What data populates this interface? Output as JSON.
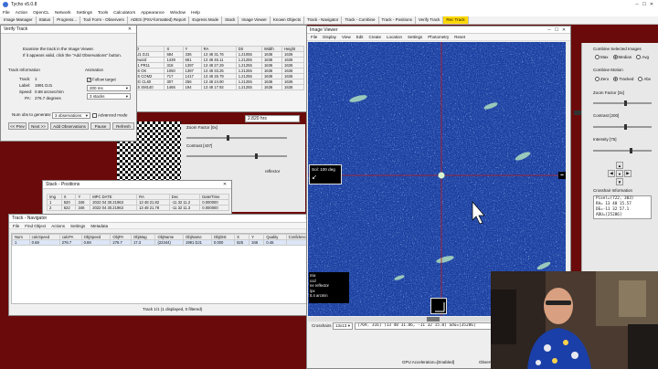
{
  "app": {
    "title": "Tycho v5.0.8",
    "icon": "tycho-app-icon",
    "menu": [
      "File",
      "Action",
      "OpenCL",
      "Network",
      "Settings",
      "Tools",
      "Calculators",
      "Appearance",
      "Window",
      "Help"
    ],
    "tabs": [
      "Image Manager",
      "Status",
      "Progress...",
      "Tool Form - Observers",
      "ADES (PSV-formatted) Report",
      "Express Mode",
      "Stack",
      "Image Viewer",
      "Known Objects",
      "Track - Navigator",
      "Track - Combine",
      "Track - Positions",
      "Verify Track",
      "Rec Track"
    ],
    "active_tab_index": 13
  },
  "verify": {
    "title": "Verify Track",
    "instr1": "Examine the track in the Image Viewer.",
    "instr2": "If it appears valid, click the \"Add Observations\" button.",
    "info_header": "Track Information",
    "track_label": "Track:",
    "track_value": "1",
    "label_label": "Label:",
    "label_value": "1991 DJ1",
    "speed_label": "Speed:",
    "speed_value": "0.68 arcsec/min",
    "pa_label": "PA:",
    "pa_value": "276.7 degrees",
    "anim_header": "Animation",
    "follow_label": "Follow target",
    "anim_speed": "200 ms",
    "anim_frames": "3 stacks",
    "num_obs_label": "Num obs to generate:",
    "num_obs_value": "3 observations",
    "advanced_label": "Advanced mode",
    "buttons": [
      "<< Prev",
      "Next >>",
      "Add Observations",
      "Pause",
      "Refresh"
    ]
  },
  "list_behind": {
    "headers": [
      "ID",
      "X",
      "Y",
      "RA",
      "Dit",
      "Width",
      "Height"
    ],
    "rows": [
      [
        "LJ1 DJ1",
        "684",
        "336",
        "13 48 31.76",
        "1.21055",
        "1636",
        "1636"
      ],
      [
        "ieward",
        "1439",
        "661",
        "13 48 46.11",
        "1.21255",
        "1636",
        "1636"
      ],
      [
        "51 PR11",
        "318",
        "1397",
        "13 48 27.29",
        "1.21255",
        "1636",
        "1636"
      ],
      [
        "9S OK",
        "1050",
        "1387",
        "13 48 33.25",
        "1.21255",
        "1636",
        "1636"
      ],
      [
        "8S COM2",
        "717",
        "1417",
        "13 48 26.79",
        "1.21255",
        "1636",
        "1636"
      ],
      [
        "EG CL60",
        "307",
        "256",
        "13 48 24.90",
        "1.21255",
        "1636",
        "1636"
      ],
      [
        "5S SM140",
        "1466",
        "194",
        "13 48 17.92",
        "1.21255",
        "1636",
        "1636"
      ]
    ]
  },
  "stack_readout": "2.820 hrs",
  "zoom_mid": {
    "zoom_label": "Zoom Factor [0x]",
    "contrast_label": "Contrast [437]",
    "reflector_label": "reflector"
  },
  "positions": {
    "title": "Stack - Positions",
    "headers": [
      "Img",
      "X",
      "Y",
      "MPC DATE",
      "RA",
      "Dec",
      "Date/Time"
    ],
    "rows": [
      [
        "1",
        "620",
        "346",
        "2022 04 30.21963",
        "13 48 21.82",
        "-11 32 11.2",
        "0.000000"
      ],
      [
        "2",
        "622",
        "346",
        "2022 04 30.21963",
        "13 48 21.78",
        "-11 32 11.3",
        "0.000000"
      ]
    ]
  },
  "navigator": {
    "title": "Track - Navigator",
    "menu": [
      "File",
      "Find Object",
      "Actions",
      "Settings",
      "Metadata"
    ],
    "headers": [
      "Num",
      "calcSpeed",
      "calcPA",
      "ObjSpeed",
      "ObjPA",
      "ObjMag",
      "ObjName",
      "ObjName",
      "ObjDist",
      "X",
      "Y",
      "Quality",
      "Confidence"
    ],
    "rows": [
      [
        "1",
        "0.68",
        "276.7",
        "0.69",
        "276.7",
        "17.3",
        "(22344)",
        "1991 DJ1",
        "0.000",
        "625",
        "346",
        "0.46",
        ""
      ]
    ],
    "status": "Track 1/1 (1 displayed, 0 filtered)"
  },
  "viewer": {
    "title": "Image Viewer",
    "menu": [
      "File",
      "Display",
      "View",
      "Edit",
      "Create",
      "Location",
      "Settings",
      "Photometry",
      "Reset"
    ],
    "overlay_sol": "Sol: 100 deg",
    "overlay_left": [
      "mix",
      "ccd",
      "ne reflector",
      "/px",
      "5.4 arcmin"
    ],
    "crosshairs_label": "Crosshairs",
    "crosshairs_value": "13x13",
    "coord_readout": "[769, 316] (13 48 31.86, -11 32 15.0) adu=[35286]",
    "gpu": "GPU Acceleration=[Enabled]",
    "obs": "Observ..."
  },
  "right": {
    "combine_title": "Combine Selected Images",
    "combine_opts": [
      "Max",
      "Median",
      "Avg"
    ],
    "combine_selected": 1,
    "motion_title": "Combine Motion",
    "motion_opts": [
      "Zero",
      "Tracked",
      "Abv"
    ],
    "motion_selected": 1,
    "zoom_label": "Zoom Factor [3x]",
    "contrast_label": "Contrast [200]",
    "intensity_label": "Intensity [75]",
    "crosshair_title": "Crosshair Information",
    "crosshair_lines": [
      "Pixel=(722, 303)",
      "RA= 13 48 15.57",
      "DE=-11 32 57.1",
      "ADU=[25286]"
    ]
  },
  "colors": {
    "desktop": "#6b0a0a",
    "active_tab": "#ffd800",
    "star_field": "#2a4fb8",
    "crosshair": "#c01818"
  }
}
